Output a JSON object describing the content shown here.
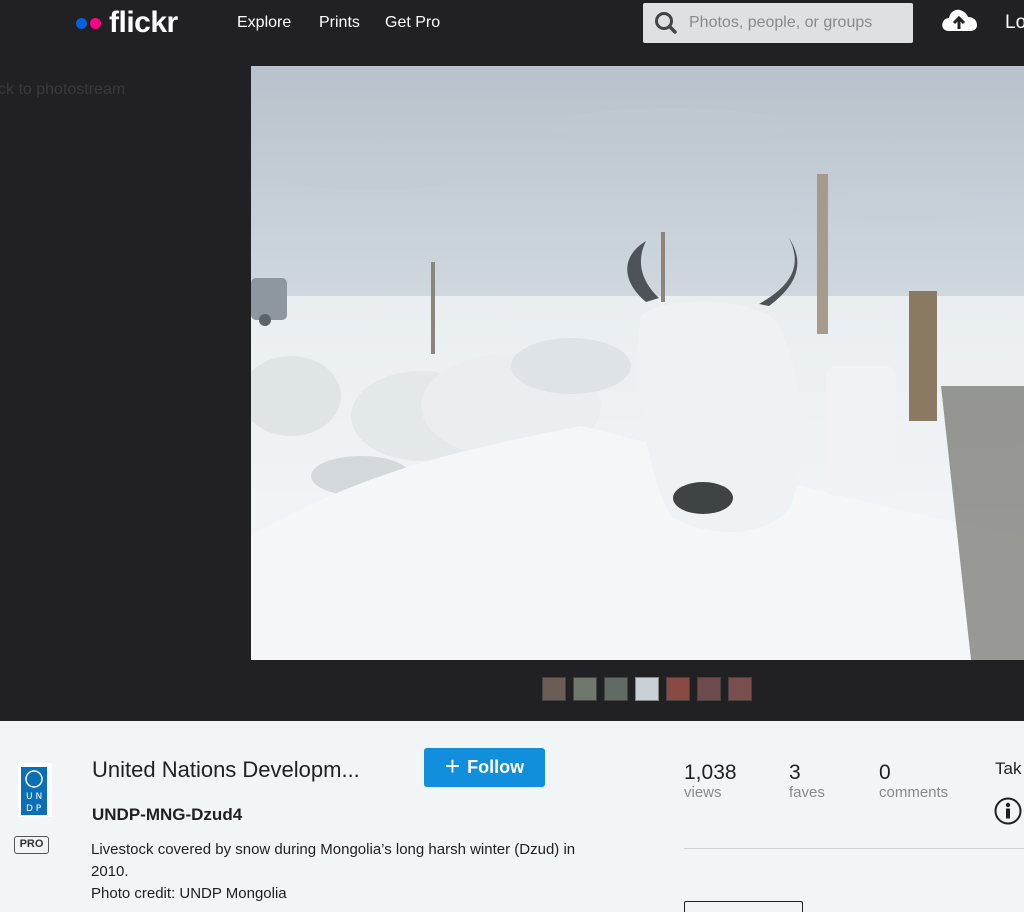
{
  "nav": {
    "logo": "flickr",
    "links": [
      "Explore",
      "Prints",
      "Get Pro"
    ],
    "search_placeholder": "Photos, people, or groups",
    "login_fragment": "Lo"
  },
  "stage": {
    "back_link": "ck to photostream"
  },
  "owner": {
    "name": "United Nations Developm...",
    "badge": "PRO",
    "follow_label": "Follow"
  },
  "photo": {
    "title": "UNDP-MNG-Dzud4",
    "description_line1": "Livestock covered by snow during Mongolia’s long harsh winter (Dzud) in 2010.",
    "description_line2": "Photo credit: UNDP Mongolia"
  },
  "stats": {
    "views": {
      "value": "1,038",
      "label": "views"
    },
    "faves": {
      "value": "3",
      "label": "faves"
    },
    "comments": {
      "value": "0",
      "label": "comments"
    }
  },
  "taken_fragment": "Tak",
  "colors": {
    "nav_bg": "#212124",
    "accent_blue": "#128fdc",
    "flickr_blue": "#0063dc",
    "flickr_pink": "#ff0084"
  }
}
